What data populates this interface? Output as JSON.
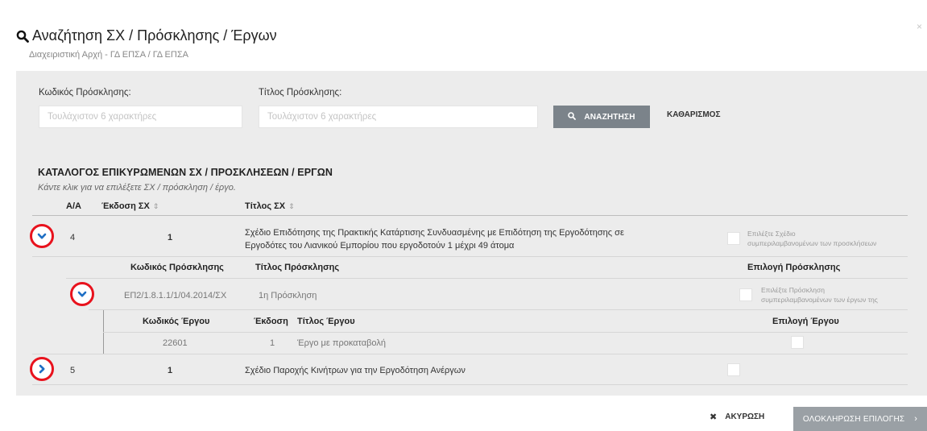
{
  "header": {
    "title": "Αναζήτηση ΣΧ / Πρόσκλησης / Έργων",
    "subtitle": "Διαχειριστική Αρχή - ΓΔ ΕΠΣΑ / ΓΔ ΕΠΣΑ",
    "close": "×"
  },
  "search": {
    "code_label": "Κωδικός Πρόσκλησης:",
    "code_placeholder": "Τουλάχιστον 6 χαρακτήρες",
    "title_label": "Τίτλος Πρόσκλησης:",
    "title_placeholder": "Τουλάχιστον 6 χαρακτήρες",
    "search_button": "ΑΝΑΖΗΤΗΣΗ",
    "clear_button": "ΚΑΘΑΡΙΣΜΟΣ"
  },
  "catalog": {
    "title": "ΚΑΤΑΛΟΓΟΣ ΕΠΙΚΥΡΩΜΕΝΩΝ ΣΧ / ΠΡΟΣΚΛΗΣΕΩΝ / ΕΡΓΩΝ",
    "hint": "Κάντε κλικ για να επιλέξετε ΣΧ / πρόσκληση / έργο.",
    "columns": {
      "aa": "Α/Α",
      "version": "Έκδοση ΣΧ",
      "title": "Τίτλος ΣΧ",
      "sort": "⇕"
    },
    "plans": [
      {
        "aa": "4",
        "version": "1",
        "title_line1": "Σχέδιο Επιδότησης της Πρακτικής Κατάρτισης Συνδυασμένης με Επιδότηση της Εργοδότησης σε",
        "title_line2": "Εργοδότες του Λιανικού Εμπορίου που εργοδοτούν 1 μέχρι 49 άτομα",
        "select_line1": "Επιλέξτε Σχέδιο",
        "select_line2": "συμπεριλαμβανομένων των προσκλήσεων",
        "expanded": true
      },
      {
        "aa": "5",
        "version": "1",
        "title_line1": "Σχέδιο Παροχής Κινήτρων για την Εργοδότηση Ανέργων",
        "expanded": false
      }
    ],
    "invitations": {
      "columns": {
        "code": "Κωδικός Πρόσκλησης",
        "title": "Τίτλος Πρόσκλησης",
        "select": "Επιλογή Πρόσκλησης"
      },
      "row": {
        "code": "ΕΠ2/1.8.1.1/1/04.2014/ΣΧ",
        "title": "1η Πρόσκληση",
        "select_line1": "Επιλέξτε Πρόσκληση",
        "select_line2": "συμπεριλαμβανομένων των έργων της"
      }
    },
    "projects": {
      "columns": {
        "code": "Κωδικός Έργου",
        "version": "Έκδοση",
        "title": "Τίτλος Έργου",
        "select": "Επιλογή Έργου"
      },
      "row": {
        "code": "22601",
        "version": "1",
        "title": "Έργο με προκαταβολή"
      }
    }
  },
  "footer": {
    "cancel": "ΑΚΥΡΩΣΗ",
    "complete": "ΟΛΟΚΛΗΡΩΣΗ ΕΠΙΛΟΓΗΣ",
    "complete_arrow": "›"
  },
  "colors": {
    "accent_red": "#e8121d",
    "toggle_blue": "#1f6fc4",
    "button_gray": "#7b838a"
  }
}
